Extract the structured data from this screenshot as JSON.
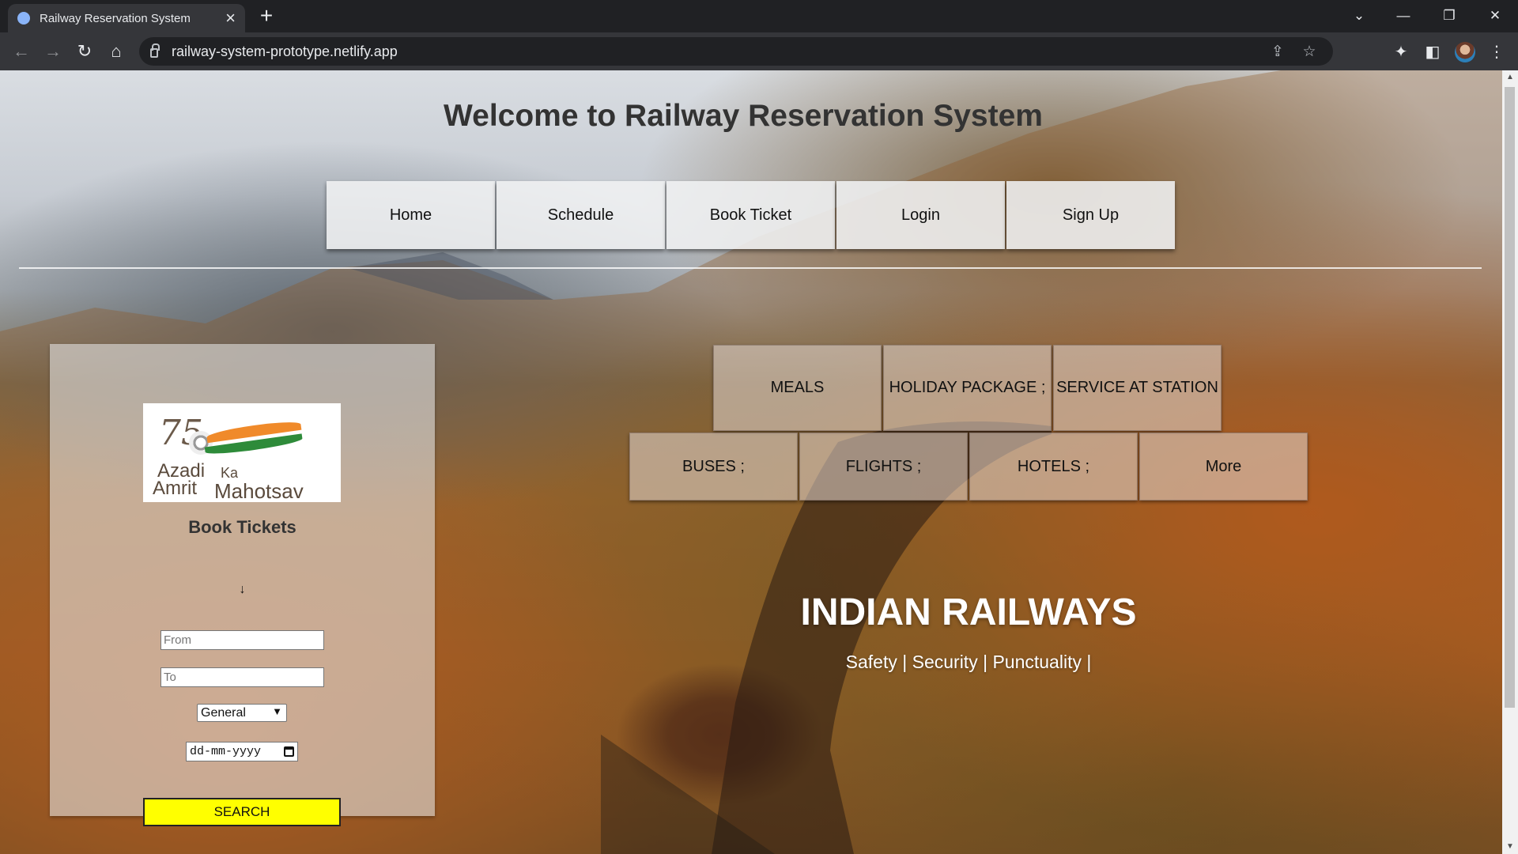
{
  "browser": {
    "tab_title": "Railway Reservation System",
    "url": "railway-system-prototype.netlify.app",
    "icons": [
      "back-icon",
      "forward-icon",
      "reload-icon",
      "home-icon",
      "lock-icon",
      "share-icon",
      "star-icon",
      "extensions-icon",
      "side-panel-icon",
      "avatar",
      "menu-icon",
      "tab-search-icon",
      "minimize-icon",
      "restore-icon",
      "close-icon",
      "new-tab-icon"
    ]
  },
  "page": {
    "title": "Welcome to Railway Reservation System",
    "nav": [
      {
        "label": "Home"
      },
      {
        "label": "Schedule"
      },
      {
        "label": "Book Ticket"
      },
      {
        "label": "Login"
      },
      {
        "label": "Sign Up"
      }
    ],
    "booking": {
      "logo": {
        "number": "75",
        "line1a": "Azadi",
        "line1b": "Ka",
        "line2a": "Amrit",
        "line2b": "Mahotsav"
      },
      "title": "Book Tickets",
      "from_placeholder": "From",
      "to_placeholder": "To",
      "swap_arrow": "↓",
      "class_selected": "General",
      "date_placeholder": "dd-mm-yyyy",
      "search_label": "SEARCH"
    },
    "services_row1": [
      {
        "label": "MEALS"
      },
      {
        "label": "HOLIDAY PACKAGE ;"
      },
      {
        "label": "SERVICE AT STATION"
      }
    ],
    "services_row2": [
      {
        "label": "BUSES ;"
      },
      {
        "label": "FLIGHTS ;"
      },
      {
        "label": "HOTELS ;"
      },
      {
        "label": "More"
      }
    ],
    "brand": "INDIAN RAILWAYS",
    "tagline": "Safety | Security | Punctuality |"
  },
  "colors": {
    "search_button": "#ffff00",
    "browser_frame": "#202124",
    "toolbar": "#35363a"
  }
}
